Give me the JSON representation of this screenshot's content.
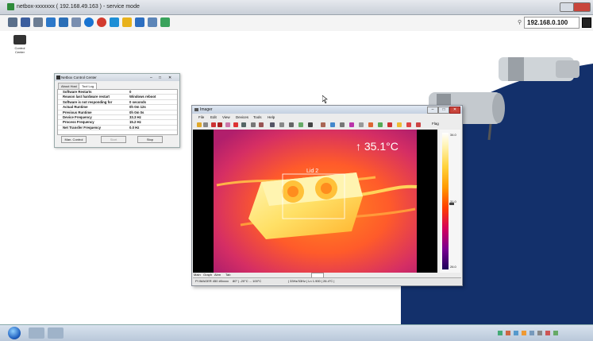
{
  "remote_window": {
    "title": "netbox-xxxxxxx ( 192.168.49.163 ) - service mode",
    "address": "192.168.0.100"
  },
  "desktop": {
    "icon_label": "Control Center"
  },
  "netbox_control_center": {
    "title": "Netbox Control Center",
    "tabs": [
      "About Host",
      "Tool Log"
    ],
    "rows": [
      {
        "key": "Software Restarts",
        "value": "0"
      },
      {
        "key": "Reason last hardware restart",
        "value": "Windows reboot"
      },
      {
        "key": "Software is not responding for",
        "value": "0 seconds"
      },
      {
        "key": "Actual Runtime",
        "value": "0h 0m 12s"
      },
      {
        "key": "Previous Runtime",
        "value": "0h 0m 0s"
      },
      {
        "key": "Device Frequency",
        "value": "33.3 Hz"
      },
      {
        "key": "Process Frequency",
        "value": "15.2 Hz"
      },
      {
        "key": "Net Transfer Frequency",
        "value": "0.0 Hz"
      }
    ],
    "buttons": [
      "Man. Control",
      "Start",
      "Stop"
    ]
  },
  "imager": {
    "title": "Imager",
    "menu": [
      "File",
      "Edit",
      "View",
      "Devices",
      "Tools",
      "Help"
    ],
    "flag_label": "Flag",
    "temperature": "35.1°C",
    "box_label": "Lid 2",
    "scale": {
      "max": "34.0",
      "mid": "31.0",
      "min": "26.0"
    },
    "bottom_tabs": [
      "Main",
      "Graph",
      "Alrm",
      "Tab"
    ],
    "status": {
      "device": "PI IMAGER 450 #0xxxx",
      "fov": "80° | -20°C ... 100°C",
      "frame": "| 33Hz/33Hz | Ln 1.900 | 26.4°C |"
    }
  },
  "colors": {
    "desktop_navy": "#13306b",
    "thermal_hot": "#ffe066",
    "thermal_mid": "#ff6a1a",
    "thermal_cool": "#c0206e"
  }
}
